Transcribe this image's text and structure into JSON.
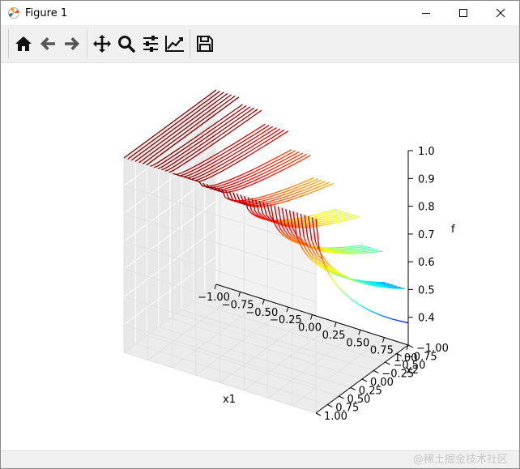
{
  "window": {
    "title": "Figure 1",
    "icons": {
      "app": "matplotlib-icon",
      "minimize": "minimize-icon",
      "maximize": "maximize-icon",
      "close": "close-icon"
    }
  },
  "toolbar": {
    "buttons": [
      {
        "name": "home-button",
        "icon": "home-icon"
      },
      {
        "name": "back-button",
        "icon": "arrow-left-icon"
      },
      {
        "name": "forward-button",
        "icon": "arrow-right-icon"
      },
      {
        "name": "pan-button",
        "icon": "move-icon"
      },
      {
        "name": "zoom-button",
        "icon": "magnifier-icon"
      },
      {
        "name": "configure-subplots-button",
        "icon": "sliders-icon"
      },
      {
        "name": "edit-axes-button",
        "icon": "line-chart-icon"
      },
      {
        "name": "save-button",
        "icon": "floppy-disk-icon"
      }
    ]
  },
  "status": {
    "watermark": "@稀土掘金技术社区"
  },
  "chart_data": {
    "type": "line",
    "projection": "3d",
    "title": "",
    "xlabel": "x1",
    "ylabel": "x2",
    "zlabel": "f",
    "xlim": [
      -1.0,
      1.0
    ],
    "ylim": [
      -1.0,
      1.0
    ],
    "zlim": [
      0.3,
      1.0
    ],
    "x_ticks": [
      "−1.00",
      "−0.75",
      "−0.50",
      "−0.25",
      "0.00",
      "0.25",
      "0.50",
      "0.75",
      "1.00"
    ],
    "y_ticks": [
      "−1.00",
      "−0.75",
      "−0.50",
      "−0.25",
      "0.00",
      "0.25",
      "0.50",
      "0.75",
      "1.00"
    ],
    "z_ticks": [
      "0.4",
      "0.5",
      "0.6",
      "0.7",
      "0.8",
      "0.9",
      "1.0"
    ],
    "colormap": "jet",
    "grid": true,
    "series_description": "family of lines along x2 drawn at many x1 values; each line is colored by f along its length",
    "approx_top_f": 1.0,
    "approx_min_f": 0.35
  }
}
